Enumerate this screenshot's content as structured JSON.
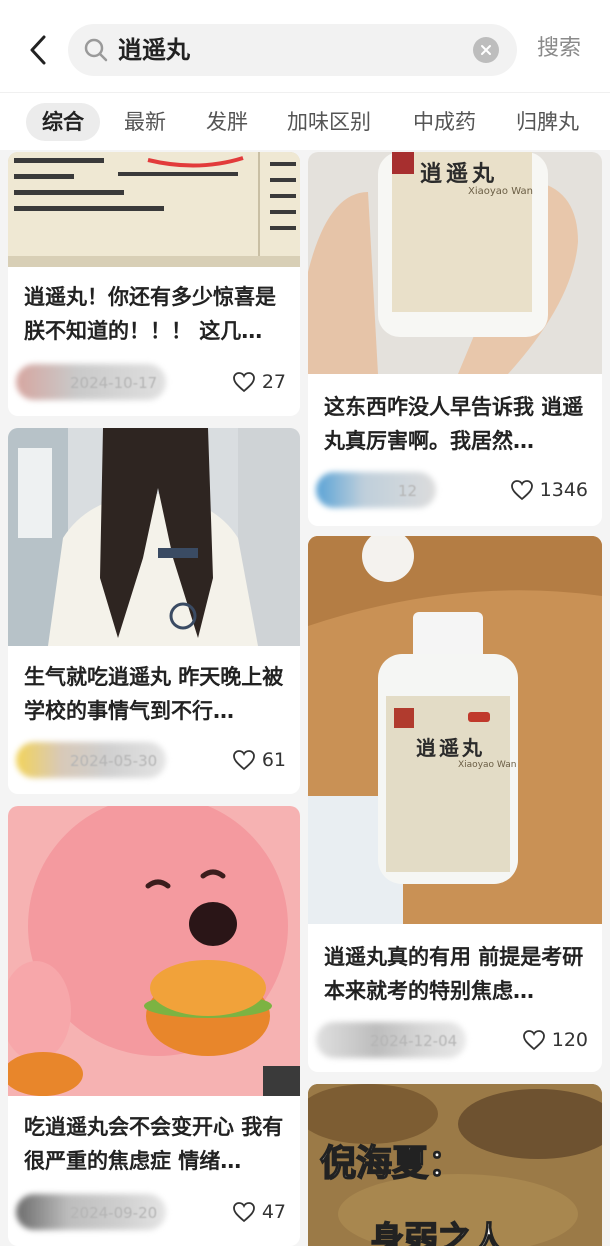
{
  "header": {
    "search_query": "逍遥丸",
    "search_button_label": "搜索"
  },
  "tabs": [
    {
      "label": "综合",
      "active": true
    },
    {
      "label": "最新"
    },
    {
      "label": "发胖"
    },
    {
      "label": "加味区别"
    },
    {
      "label": "中成药"
    },
    {
      "label": "归脾丸"
    }
  ],
  "feed": {
    "left": [
      {
        "title": "逍遥丸！你还有多少惊喜是朕不知道的！！！ 这几…",
        "date": "2024-10-17",
        "likes": "27",
        "image_desc": "medicine-leaflet-photo"
      },
      {
        "title": "生气就吃逍遥丸 昨天晚上被学校的事情气到不行…",
        "date": "2024-05-30",
        "likes": "61",
        "image_desc": "girl-long-hair-photo"
      },
      {
        "title": "吃逍遥丸会不会变开心 我有很严重的焦虑症 情绪…",
        "date": "2024-09-20",
        "likes": "47",
        "image_desc": "pink-cartoon-burger"
      }
    ],
    "right": [
      {
        "title": "这东西咋没人早告诉我 逍遥丸真厉害啊。我居然…",
        "date": "12",
        "likes": "1346",
        "image_desc": "medicine-bottle-in-hand",
        "bottle_label": "逍遥丸",
        "bottle_sub": "Xiaoyao Wan"
      },
      {
        "title": "逍遥丸真的有用 前提是考研本来就考的特别焦虑…",
        "date": "2024-12-04",
        "likes": "120",
        "image_desc": "medicine-bottle-on-table",
        "bottle_label": "逍遥丸",
        "bottle_sub": "Xiaoyao Wan"
      },
      {
        "title": "",
        "overlay_text": "倪海夏：",
        "overlay_text2": "身弱之人",
        "image_desc": "ancient-painting"
      }
    ]
  },
  "colors": {
    "page_bg": "#f4f4f4",
    "card_bg": "#ffffff",
    "muted": "#8a8a8a"
  }
}
